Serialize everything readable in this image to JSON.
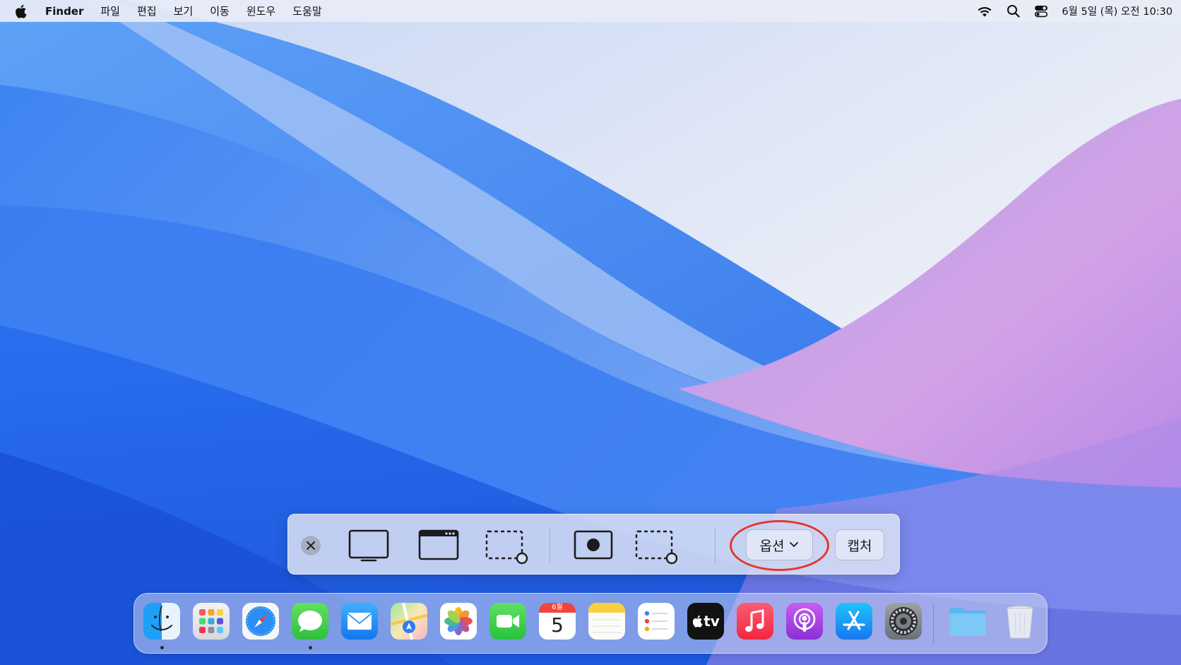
{
  "menubar": {
    "apple_icon": "apple-logo-icon",
    "app_name": "Finder",
    "items": [
      "파일",
      "편집",
      "보기",
      "이동",
      "윈도우",
      "도움말"
    ],
    "status_icons": [
      "wifi-icon",
      "search-icon",
      "control-center-icon"
    ],
    "clock": "6월 5일 (목) 오전 10:30"
  },
  "capture_toolbar": {
    "tools": [
      {
        "name": "close",
        "icon": "close-icon"
      },
      {
        "name": "capture-entire-screen",
        "icon": "screen-icon"
      },
      {
        "name": "capture-window",
        "icon": "window-icon"
      },
      {
        "name": "capture-selection",
        "icon": "selection-icon"
      },
      {
        "name": "record-entire-screen",
        "icon": "record-screen-icon"
      },
      {
        "name": "record-selection",
        "icon": "record-selection-icon"
      }
    ],
    "options_label": "옵션",
    "options_icon": "chevron-down-icon",
    "capture_label": "캡처",
    "highlight_color": "#e8342b"
  },
  "dock": {
    "apps": [
      {
        "name": "finder",
        "running": true
      },
      {
        "name": "launchpad",
        "running": false
      },
      {
        "name": "safari",
        "running": false
      },
      {
        "name": "messages",
        "running": true
      },
      {
        "name": "mail",
        "running": false
      },
      {
        "name": "maps",
        "running": false
      },
      {
        "name": "photos",
        "running": false
      },
      {
        "name": "facetime",
        "running": false
      },
      {
        "name": "calendar",
        "running": false
      },
      {
        "name": "notes",
        "running": false
      },
      {
        "name": "reminders",
        "running": false
      },
      {
        "name": "apple-tv",
        "running": false
      },
      {
        "name": "music",
        "running": false
      },
      {
        "name": "podcasts",
        "running": false
      },
      {
        "name": "app-store",
        "running": false
      },
      {
        "name": "system-settings",
        "running": false
      }
    ],
    "calendar_month": "6월",
    "calendar_day": "5",
    "tv_label": "tv",
    "folder_icon": "folder-icon",
    "trash_icon": "trash-icon"
  },
  "colors": {
    "accent_red": "#e8342b",
    "wallpaper_blue": "#2f6fea",
    "wallpaper_purple": "#b993e6"
  }
}
